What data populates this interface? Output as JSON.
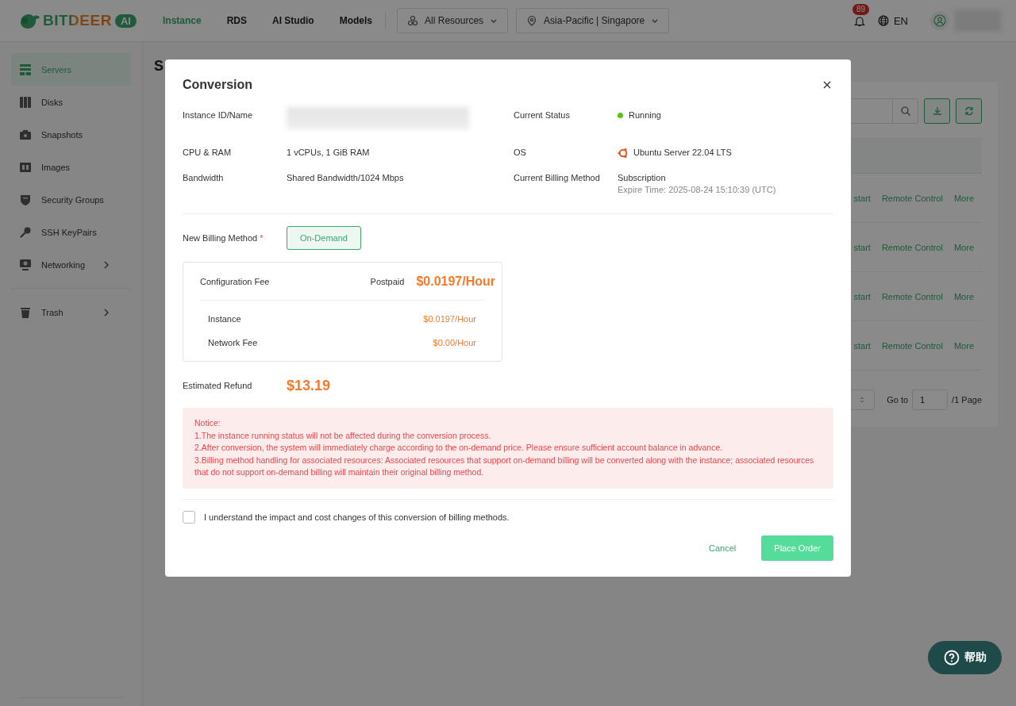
{
  "header": {
    "logo_text": "BITDEER",
    "logo_badge": "AI",
    "nav": [
      {
        "label": "Instance",
        "selected": true
      },
      {
        "label": "RDS",
        "selected": false
      },
      {
        "label": "AI Studio",
        "selected": false
      },
      {
        "label": "Models",
        "selected": false
      }
    ],
    "resource_filter": "All Resources",
    "region": "Asia-Pacific | Singapore",
    "notification_count": "89",
    "language": "EN"
  },
  "sidebar": {
    "items": [
      {
        "label": "Servers",
        "selected": true,
        "expandable": false
      },
      {
        "label": "Disks",
        "selected": false,
        "expandable": false
      },
      {
        "label": "Snapshots",
        "selected": false,
        "expandable": false
      },
      {
        "label": "Images",
        "selected": false,
        "expandable": false
      },
      {
        "label": "Security Groups",
        "selected": false,
        "expandable": false
      },
      {
        "label": "SSH KeyPairs",
        "selected": false,
        "expandable": false
      },
      {
        "label": "Networking",
        "selected": false,
        "expandable": true
      }
    ],
    "bottom_items": [
      {
        "label": "Trash",
        "selected": false,
        "expandable": true
      }
    ]
  },
  "page": {
    "title": "S",
    "rows": [
      {
        "actions": [
          "start",
          "Remote Control",
          "More"
        ]
      },
      {
        "actions": [
          "start",
          "Remote Control",
          "More"
        ]
      },
      {
        "actions": [
          "start",
          "Remote Control",
          "More"
        ]
      },
      {
        "actions": [
          "start",
          "Remote Control",
          "More"
        ]
      }
    ],
    "pagination": {
      "goto_label": "Go to",
      "page_value": "1",
      "page_total": "/1 Page"
    }
  },
  "dialog": {
    "title": "Conversion",
    "info": [
      {
        "label": "Instance ID/Name",
        "kind": "redacted"
      },
      {
        "label": "Current Status",
        "kind": "status",
        "value": "Running",
        "color": "#52c41a"
      },
      {
        "label": "CPU & RAM",
        "kind": "text",
        "value": "1 vCPUs, 1 GiB RAM"
      },
      {
        "label": "OS",
        "kind": "os",
        "value": "Ubuntu Server 22.04 LTS"
      },
      {
        "label": "Bandwidth",
        "kind": "text",
        "value": "Shared Bandwidth/1024 Mbps"
      },
      {
        "label": "Current Billing Method",
        "kind": "note",
        "value": "Subscription",
        "note": "Expire Time: 2025-08-24 15:10:39 (UTC)"
      }
    ],
    "billing_label": "New Billing Method",
    "required_mark": "*",
    "billing_options": [
      {
        "label": "On-Demand",
        "selected": true
      }
    ],
    "fee": {
      "label": "Configuration Fee",
      "mode": "Postpaid",
      "total": "$0.0197/Hour",
      "items": [
        {
          "label": "Instance",
          "price": "$0.0197/Hour"
        },
        {
          "label": "Network Fee",
          "price": "$0.00/Hour"
        }
      ]
    },
    "refund_label": "Estimated Refund",
    "refund": "$13.19",
    "notice": {
      "title": "Notice:",
      "lines": [
        "1.The instance running status will not be affected during the conversion process.",
        "2.After conversion, the system will immediately charge according to the on-demand price. Please ensure sufficient account balance in advance.",
        "3.Billing method handling for associated resources: Associated resources that support on-demand billing will be converted along with the instance; associated resources that do not support on-demand billing will maintain their original billing method."
      ]
    },
    "agreement": {
      "label": "I understand the impact and cost changes of this conversion of billing methods.",
      "checked": false
    },
    "buttons": [
      {
        "label": "Cancel",
        "kind": "text",
        "disabled": false
      },
      {
        "label": "Place Order",
        "kind": "primary",
        "disabled": true
      }
    ]
  },
  "help_button": "帮助"
}
